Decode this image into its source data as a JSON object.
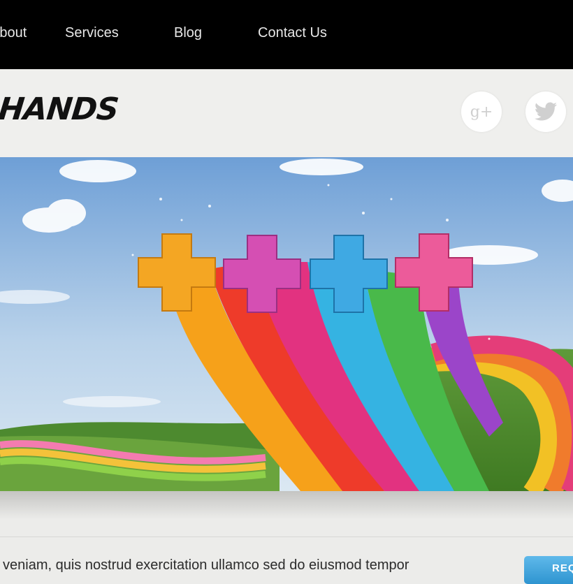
{
  "nav": {
    "about": "About",
    "services": "Services",
    "blog": "Blog",
    "contact": "Contact Us"
  },
  "header": {
    "logo_text": "HANDS",
    "social": {
      "gplus_glyph": "g+",
      "gplus_icon": "google-plus-icon",
      "twitter_icon": "twitter-icon"
    }
  },
  "hero": {
    "image": "rainbow-ribbons-with-plus-signs-over-meadow"
  },
  "content": {
    "intro_text": "veniam, quis nostrud exercitation ullamco sed do eiusmod tempor",
    "cta_label": "REQ"
  },
  "colors": {
    "nav_bg": "#000000",
    "page_bg": "#ececea",
    "button": "#3aa3dc"
  }
}
